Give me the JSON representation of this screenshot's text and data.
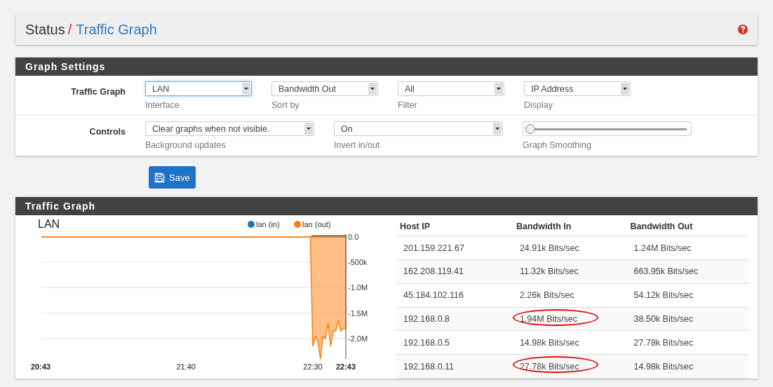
{
  "breadcrumb": {
    "section": "Status",
    "separator": "/",
    "page": "Traffic Graph"
  },
  "settings": {
    "title": "Graph Settings",
    "rows": [
      {
        "label": "Traffic Graph",
        "controls": [
          {
            "kind": "select",
            "value": "LAN",
            "help": "Interface",
            "focused": true
          },
          {
            "kind": "select",
            "value": "Bandwidth Out",
            "help": "Sort by",
            "focused": false
          },
          {
            "kind": "select",
            "value": "All",
            "help": "Filter",
            "focused": false
          },
          {
            "kind": "select",
            "value": "IP Address",
            "help": "Display",
            "focused": false
          }
        ]
      },
      {
        "label": "Controls",
        "controls": [
          {
            "kind": "select",
            "value": "Clear graphs when not visible.",
            "help": "Background updates",
            "focused": false
          },
          {
            "kind": "select",
            "value": "On",
            "help": "Invert in/out",
            "focused": false
          },
          {
            "kind": "slider",
            "level": 0,
            "help": "Graph Smoothing"
          }
        ]
      }
    ]
  },
  "save_button": "Save",
  "traffic": {
    "title": "Traffic Graph",
    "graph_title": "LAN",
    "chart_data": {
      "type": "area",
      "grid": true,
      "legend": "top-right",
      "xlim": [
        1243,
        1363
      ],
      "x": [
        1243,
        1349,
        1350,
        1351,
        1352,
        1353,
        1354,
        1355,
        1356,
        1357,
        1358,
        1359,
        1360,
        1361,
        1362,
        1363
      ],
      "xticks": [
        {
          "value": 1243,
          "label": "20:43"
        },
        {
          "value": 1300,
          "label": "21:40"
        },
        {
          "value": 1350,
          "label": "22:30"
        },
        {
          "value": 1363,
          "label": "22:43"
        }
      ],
      "yticks": [
        {
          "value": 0,
          "label": "0.0"
        },
        {
          "value": -500000,
          "label": "-500k"
        },
        {
          "value": -1000000,
          "label": "-1.0M"
        },
        {
          "value": -1500000,
          "label": "-1.5M"
        },
        {
          "value": -2000000,
          "label": "-2.0M"
        }
      ],
      "ylim": [
        -2400000,
        50000
      ],
      "series": [
        {
          "name": "lan (in)",
          "color": "#1f77b4",
          "values": [
            0,
            0,
            20000,
            20000,
            20000,
            20000,
            20000,
            20000,
            20000,
            20000,
            20000,
            20000,
            20000,
            20000,
            20000,
            20000
          ]
        },
        {
          "name": "lan (out)",
          "color": "#ff7f0e",
          "values": [
            0,
            0,
            -2150000,
            -1950000,
            -2050000,
            -2400000,
            -1950000,
            -2000000,
            -1700000,
            -2150000,
            -1850000,
            -1850000,
            -1650000,
            -1850000,
            -1800000,
            -1800000
          ]
        }
      ]
    },
    "table": {
      "columns": [
        "Host IP",
        "Bandwidth In",
        "Bandwidth Out"
      ],
      "rows": [
        {
          "cells": [
            "201.159.221.67",
            "24.91k Bits/sec",
            "1.24M Bits/sec"
          ],
          "circled": [
            false,
            false,
            false
          ]
        },
        {
          "cells": [
            "162.208.119.41",
            "11.32k Bits/sec",
            "663.95k Bits/sec"
          ],
          "circled": [
            false,
            false,
            false
          ]
        },
        {
          "cells": [
            "45.184.102.116",
            "2.26k Bits/sec",
            "54.12k Bits/sec"
          ],
          "circled": [
            false,
            false,
            false
          ]
        },
        {
          "cells": [
            "192.168.0.8",
            "1.94M Bits/sec",
            "38.50k Bits/sec"
          ],
          "circled": [
            false,
            true,
            false
          ]
        },
        {
          "cells": [
            "192.168.0.5",
            "14.98k Bits/sec",
            "27.78k Bits/sec"
          ],
          "circled": [
            false,
            false,
            false
          ]
        },
        {
          "cells": [
            "192.168.0.11",
            "27.78k Bits/sec",
            "14.98k Bits/sec"
          ],
          "circled": [
            false,
            true,
            false
          ]
        }
      ]
    }
  }
}
